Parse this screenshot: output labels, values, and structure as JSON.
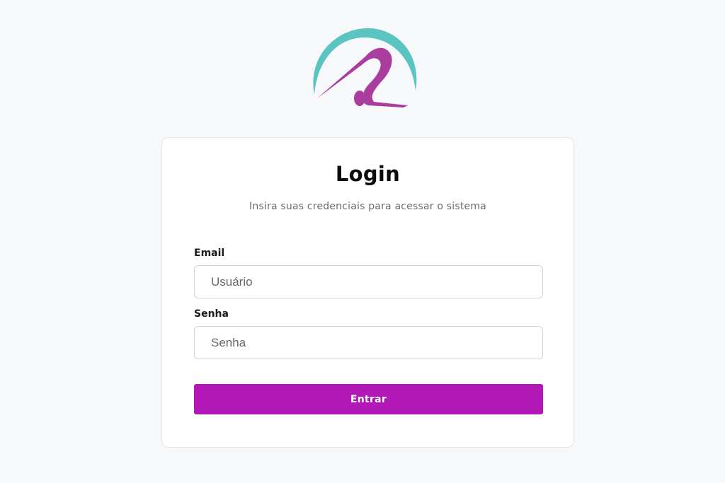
{
  "brand": {
    "logo_icon": "teal-arc-magenta-figure-logo-icon",
    "teal_color": "#5cc4c0",
    "magenta_color": "#a93e9e"
  },
  "login": {
    "title": "Login",
    "subtitle": "Insira suas credenciais para acessar o sistema",
    "email_label": "Email",
    "email_placeholder": "Usuário",
    "email_value": "",
    "password_label": "Senha",
    "password_placeholder": "Senha",
    "password_value": "",
    "submit_label": "Entrar"
  },
  "colors": {
    "background": "#f7f8fa",
    "card": "#ffffff",
    "button": "#b118b5"
  }
}
